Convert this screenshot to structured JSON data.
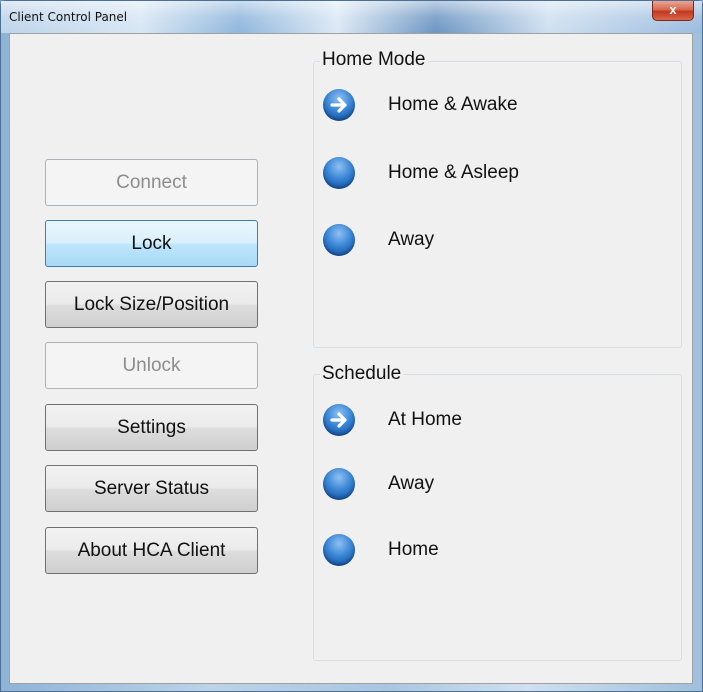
{
  "window": {
    "title": "Client Control Panel",
    "close_label": "x"
  },
  "buttons": {
    "connect": "Connect",
    "lock": "Lock",
    "lock_size_position": "Lock Size/Position",
    "unlock": "Unlock",
    "settings": "Settings",
    "server_status": "Server Status",
    "about": "About HCA Client"
  },
  "home_mode": {
    "label": "Home Mode",
    "options": [
      "Home & Awake",
      "Home & Asleep",
      "Away"
    ],
    "selected": "Home & Awake"
  },
  "schedule": {
    "label": "Schedule",
    "options": [
      "At Home",
      "Away",
      "Home"
    ],
    "selected": "At Home"
  },
  "icons": {
    "selected": "arrow-right-icon",
    "unselected": "blue-orb-icon"
  },
  "colors": {
    "orb": "#2f79cc",
    "focus_border": "#3c7fb1"
  }
}
